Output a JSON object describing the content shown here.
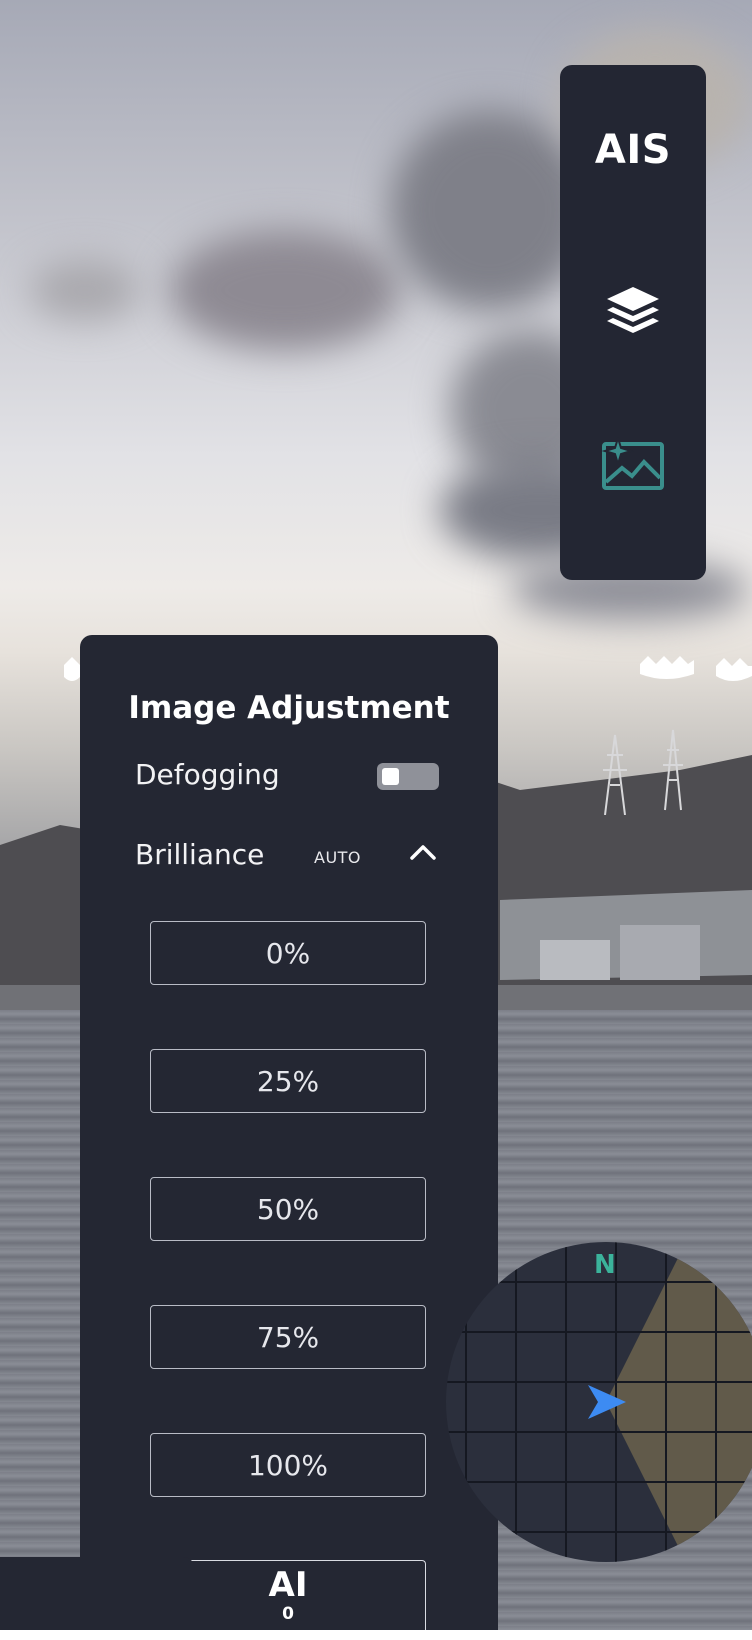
{
  "side_panel": {
    "ais_label": "AIS",
    "layers_icon": "layers-icon",
    "image_adjust_icon": "image-enhance-icon",
    "active_accent": "#3a8e8c"
  },
  "image_adjustment": {
    "title": "Image Adjustment",
    "defogging_label": "Defogging",
    "defogging_on": false,
    "brilliance_label": "Brilliance",
    "brilliance_mode": "AUTO",
    "expanded": true,
    "options": [
      "0%",
      "25%",
      "50%",
      "75%",
      "100%"
    ]
  },
  "ai_button": {
    "label": "AI",
    "count": "0"
  },
  "compass": {
    "north_label": "N",
    "north_color": "#3bb39b",
    "heading_marker_color": "#3d8bf2",
    "fov_color": "#6b624c"
  }
}
